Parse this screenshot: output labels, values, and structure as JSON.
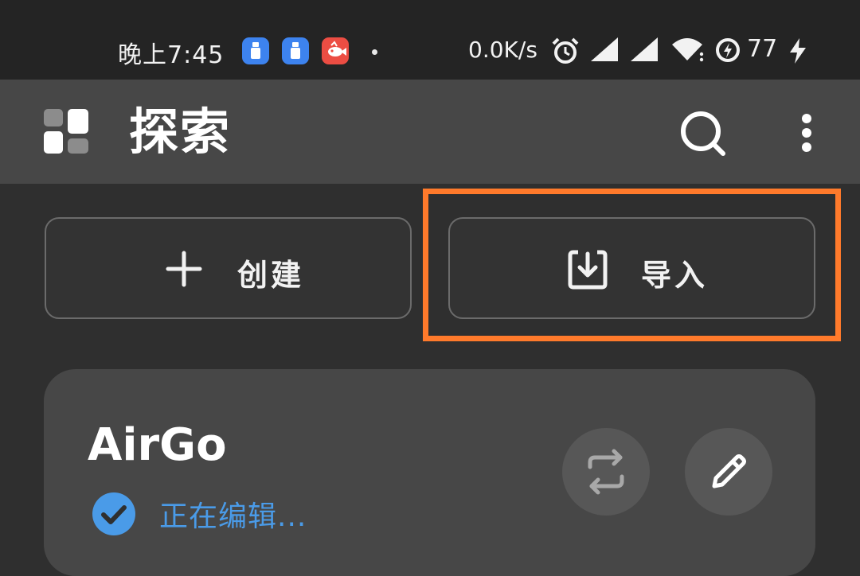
{
  "status_bar": {
    "time": "晚上7:45",
    "net_speed": "0.0K/s",
    "battery_level": "77",
    "notification_icons": [
      "usb-icon",
      "usb-icon",
      "fish-app-icon"
    ],
    "system_icons": [
      "alarm-icon",
      "cell-signal-icon",
      "cell-signal-icon",
      "wifi-icon",
      "data-saver-icon",
      "charging-icon"
    ]
  },
  "app_bar": {
    "title": "探索",
    "icons": [
      "apps-grid-icon",
      "search-icon",
      "more-vert-icon"
    ]
  },
  "actions": {
    "create_label": "创建",
    "import_label": "导入"
  },
  "profile": {
    "name": "AirGo",
    "status": "正在编辑..."
  },
  "colors": {
    "background": "#2f2f2f",
    "app_bar": "#474747",
    "status_bar": "#242424",
    "highlight": "#ff7a2b",
    "status_blue": "#4a9be8"
  }
}
